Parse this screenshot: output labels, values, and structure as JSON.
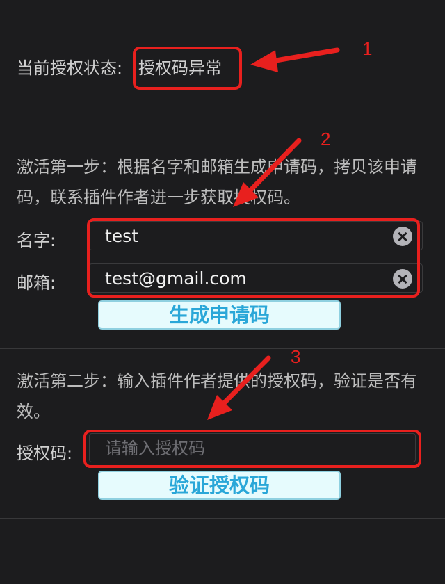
{
  "status": {
    "label": "当前授权状态:",
    "value": "授权码异常"
  },
  "step1": {
    "description": "激活第一步：根据名字和邮箱生成申请码，拷贝该申请码，联系插件作者进一步获取授权码。",
    "name_label": "名字:",
    "name_value": "test",
    "email_label": "邮箱:",
    "email_value": "test@gmail.com",
    "generate_button": "生成申请码"
  },
  "step2": {
    "description": "激活第二步：输入插件作者提供的授权码，验证是否有效。",
    "code_label": "授权码:",
    "code_placeholder": "请输入授权码",
    "verify_button": "验证授权码"
  },
  "annotations": {
    "marker_1": "1",
    "marker_2": "2",
    "marker_3": "3",
    "color": "#e8201e"
  }
}
